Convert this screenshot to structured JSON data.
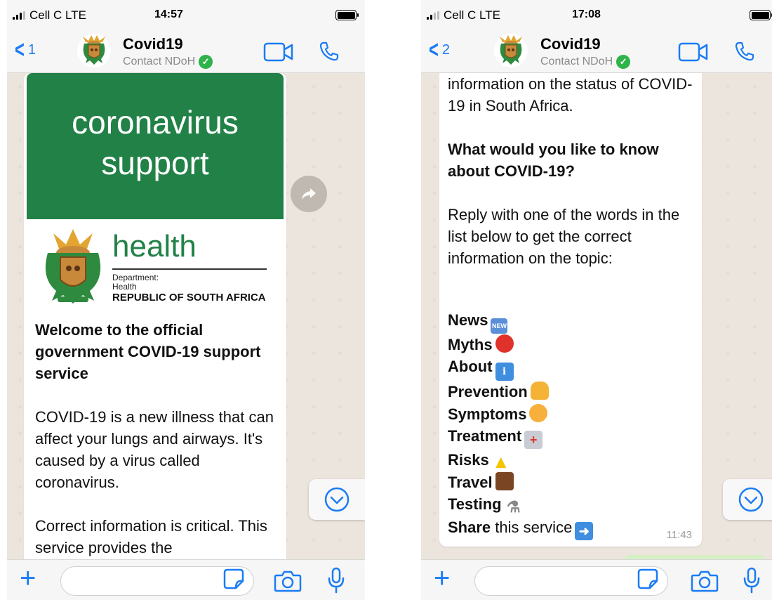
{
  "left": {
    "status": {
      "carrier": "Cell C LTE",
      "time": "14:57"
    },
    "header": {
      "back_count": "1",
      "title": "Covid19",
      "subtitle": "Contact NDoH"
    },
    "banner": {
      "line1": "coronavirus",
      "line2": "support",
      "color": "#228147"
    },
    "logo": {
      "word": "health",
      "dept": "Department:",
      "dept2": "Health",
      "country": "REPUBLIC OF SOUTH AFRICA"
    },
    "message": {
      "heading": "Welcome to the official government COVID-19 support service",
      "para1": "COVID-19 is a new illness that can affect your lungs and airways. It's caused by a virus called coronavirus.",
      "para2": "Correct information is critical. This service provides the"
    }
  },
  "right": {
    "status": {
      "carrier": "Cell C LTE",
      "time": "17:08"
    },
    "header": {
      "back_count": "2",
      "title": "Covid19",
      "subtitle": "Contact NDoH"
    },
    "message": {
      "intro": "information on the status of COVID-19 in South Africa.",
      "question": "What would you like to know about COVID-19?",
      "instruction": "Reply with one of the words in the list below to get the correct information on the topic:",
      "items": [
        {
          "word": "News",
          "emoji": "new-badge"
        },
        {
          "word": "Myths",
          "emoji": "stop-sign"
        },
        {
          "word": "About",
          "emoji": "info"
        },
        {
          "word": "Prevention",
          "emoji": "thumbs-up"
        },
        {
          "word": "Symptoms",
          "emoji": "sick-face"
        },
        {
          "word": "Treatment",
          "emoji": "hospital"
        },
        {
          "word": "Risks",
          "emoji": "warning"
        },
        {
          "word": "Travel",
          "emoji": "suitcase"
        },
        {
          "word": "Testing",
          "emoji": "microscope"
        }
      ],
      "share_word": "Share",
      "share_rest": " this service",
      "time": "11:43"
    }
  },
  "colors": {
    "accent": "#1a7cf5",
    "verified": "#2fb34a",
    "wallpaper": "#ece5dd"
  }
}
